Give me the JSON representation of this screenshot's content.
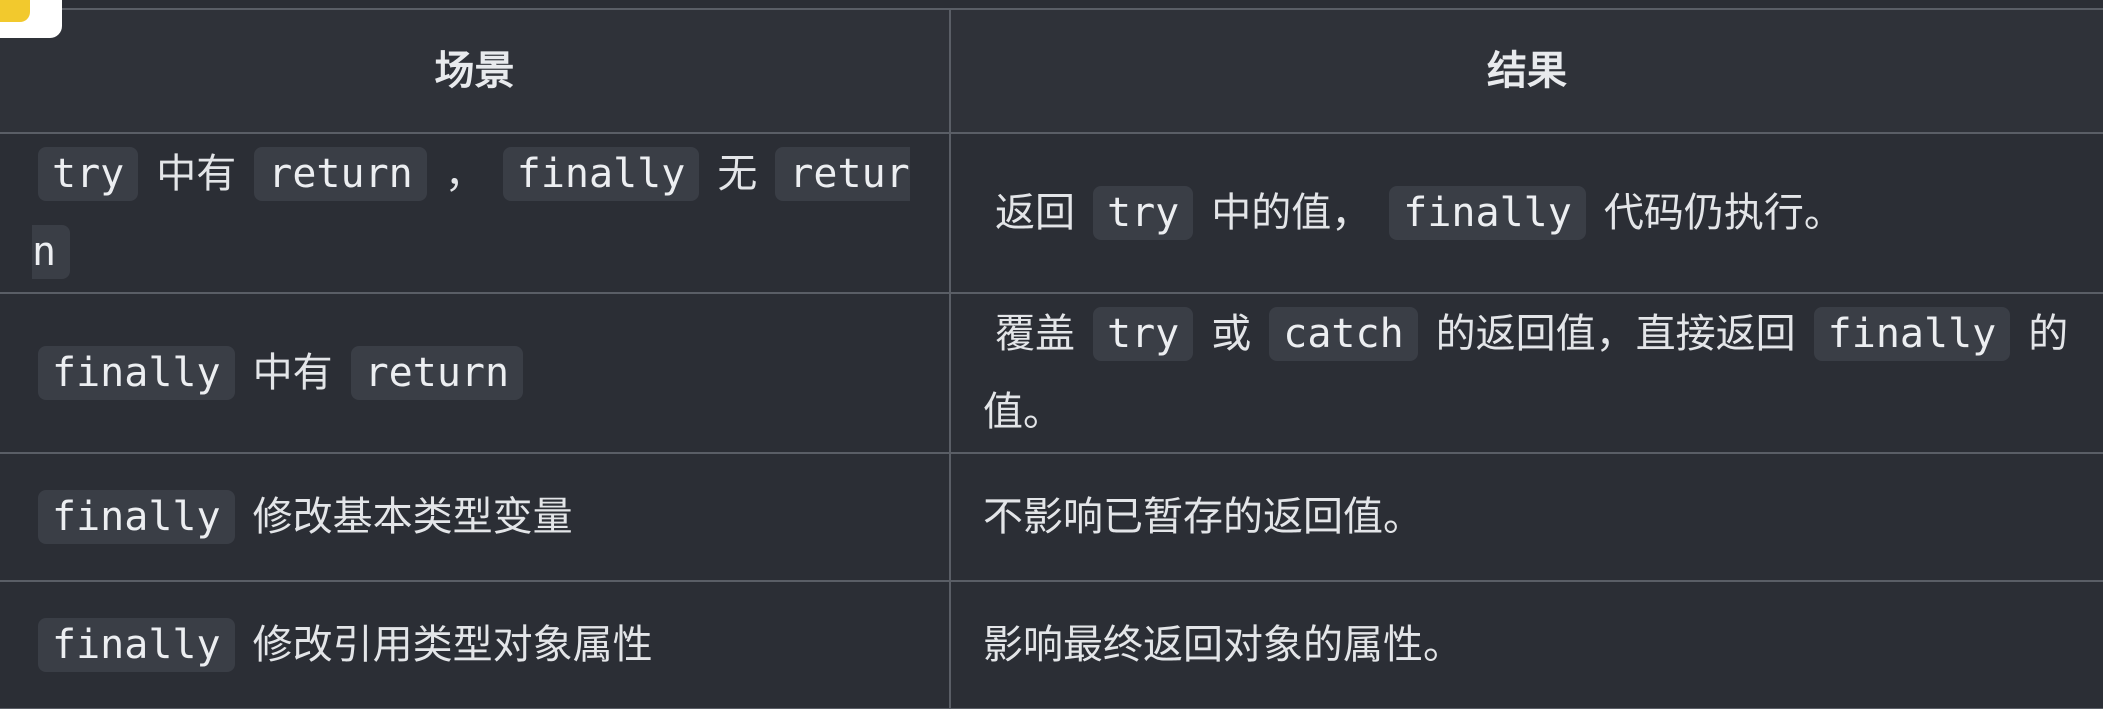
{
  "table": {
    "headers": {
      "scenario": "场景",
      "result": "结果"
    },
    "rows": [
      {
        "scenario": {
          "code1": "try",
          "t1": "中有",
          "code2": "return",
          "t2": "，",
          "code3": "finally",
          "t3": "无",
          "code4": "return"
        },
        "result": {
          "t1": "返回",
          "code1": "try",
          "t2": "中的值，",
          "code2": "finally",
          "t3": "代码仍执行。"
        }
      },
      {
        "scenario": {
          "code1": "finally",
          "t1": "中有",
          "code2": "return"
        },
        "result": {
          "t1": "覆盖",
          "code1": "try",
          "t2": "或",
          "code2": "catch",
          "t3": "的返回值，直接返回",
          "code3": "finally",
          "t4": "的值。"
        }
      },
      {
        "scenario": {
          "code1": "finally",
          "t1": "修改基本类型变量"
        },
        "result": {
          "t1": "不影响已暂存的返回值。"
        }
      },
      {
        "scenario": {
          "code1": "finally",
          "t1": "修改引用类型对象属性"
        },
        "result": {
          "t1": "影响最终返回对象的属性。"
        }
      }
    ]
  }
}
